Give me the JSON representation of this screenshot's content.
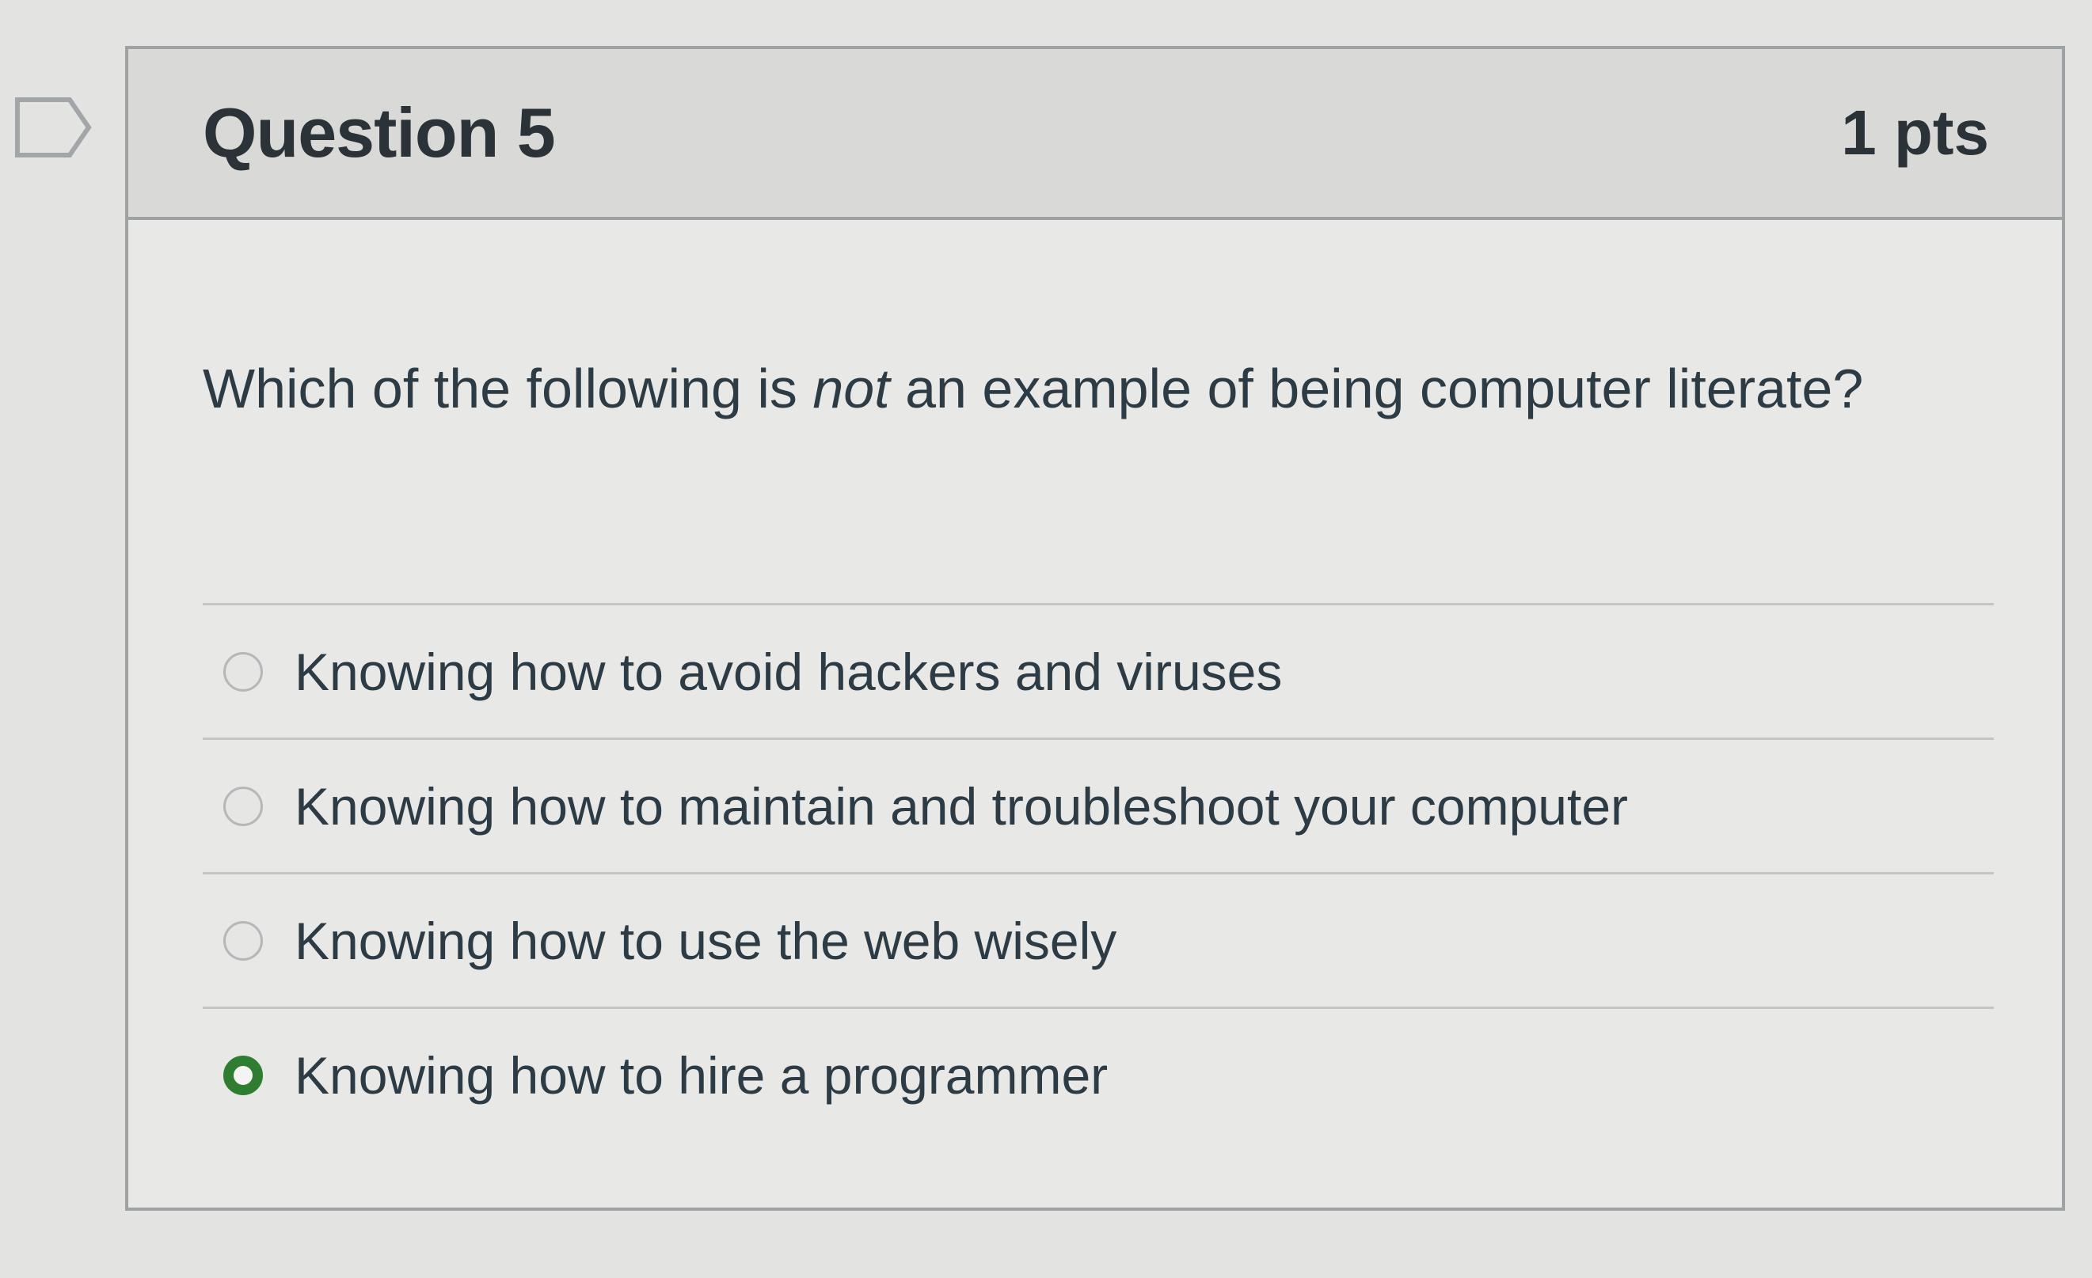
{
  "question": {
    "title": "Question 5",
    "points": "1 pts",
    "text_before": "Which of the following is ",
    "text_emphasis": "not",
    "text_after": " an example of being computer literate?"
  },
  "answers": [
    {
      "label": "Knowing how to avoid hackers and viruses",
      "selected": false
    },
    {
      "label": "Knowing how to maintain and troubleshoot your computer",
      "selected": false
    },
    {
      "label": "Knowing how to use the web wisely",
      "selected": false
    },
    {
      "label": "Knowing how to hire a programmer",
      "selected": true
    }
  ],
  "colors": {
    "selected_radio": "#2f7d30",
    "card_border": "#9ea2a3",
    "header_background": "#d9dad8"
  },
  "icons": {
    "flag": "flag-question-icon"
  }
}
